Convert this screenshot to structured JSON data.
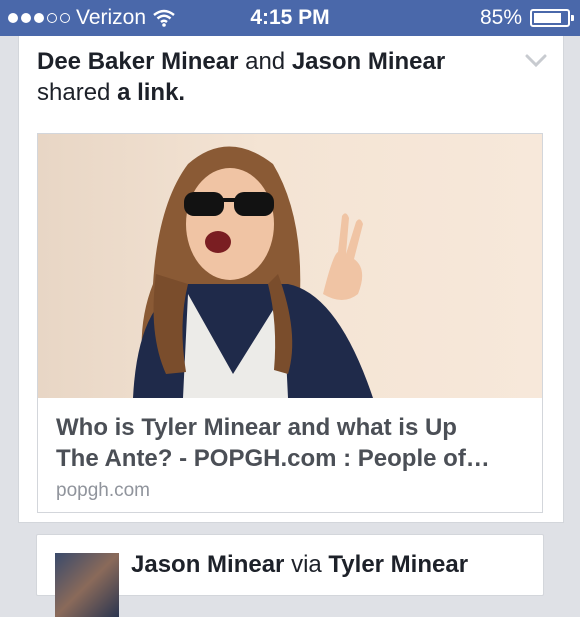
{
  "status_bar": {
    "carrier": "Verizon",
    "time": "4:15 PM",
    "battery_percent": "85%",
    "battery_level": 0.85,
    "signal_dots_filled": 3,
    "signal_dots_total": 5
  },
  "story": {
    "actor1": "Dee Baker Minear",
    "connector": "and",
    "actor2": "Jason Minear",
    "verb": "shared",
    "object": "a link.",
    "link": {
      "title": "Who is Tyler Minear and what is Up\nThe Ante? - POPGH.com : People of…",
      "domain": "popgh.com"
    }
  },
  "next_story": {
    "actor": "Jason Minear",
    "via": "via",
    "source": "Tyler Minear"
  },
  "colors": {
    "status_bar_bg": "#4a68aa",
    "page_bg": "#dfe1e6"
  }
}
